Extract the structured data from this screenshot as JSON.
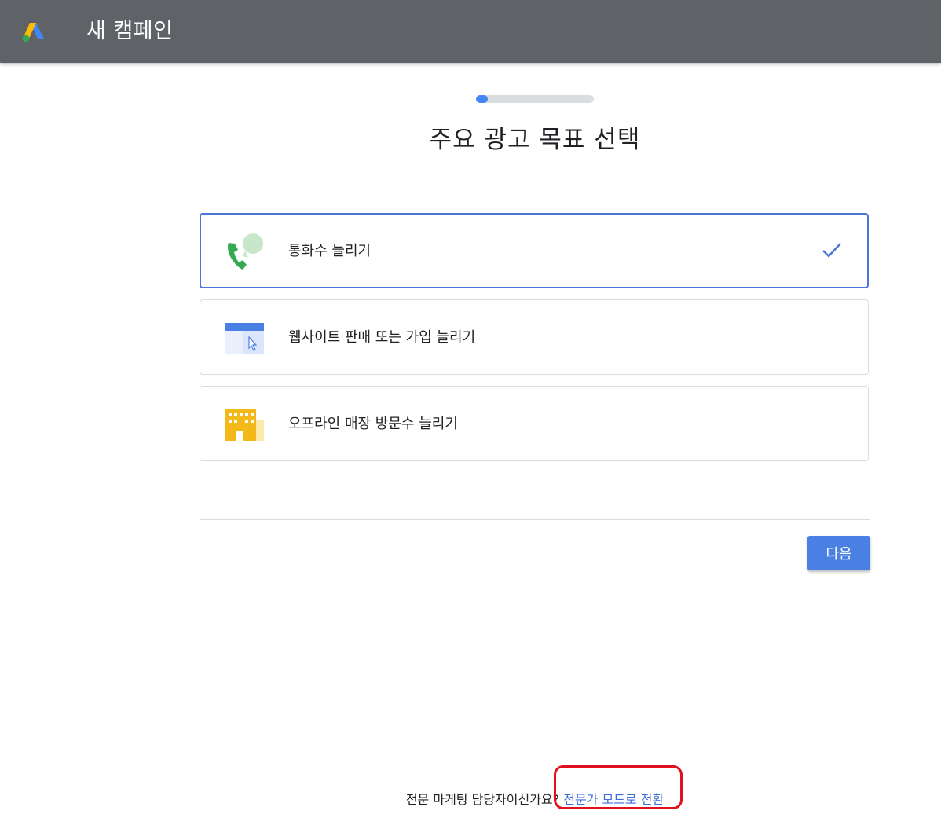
{
  "header": {
    "title": "새 캠페인",
    "logo_icon": "google-ads-logo-icon"
  },
  "wizard": {
    "progress_fraction": 0.1,
    "heading": "주요 광고 목표 선택"
  },
  "goals": [
    {
      "label": "통화수 늘리기",
      "icon": "phone-call-icon",
      "selected": true
    },
    {
      "label": "웹사이트 판매 또는 가입 늘리기",
      "icon": "website-cursor-icon",
      "selected": false
    },
    {
      "label": "오프라인 매장 방문수 늘리기",
      "icon": "storefront-icon",
      "selected": false
    }
  ],
  "actions": {
    "next_label": "다음"
  },
  "footer": {
    "question": "전문 마케팅 담당자이신가요?",
    "link_label": "전문가 모드로 전환"
  },
  "colors": {
    "header_bg": "#5f6368",
    "accent": "#4a7fe4",
    "link": "#3c6fd6",
    "annotation_red": "#e0101c"
  }
}
